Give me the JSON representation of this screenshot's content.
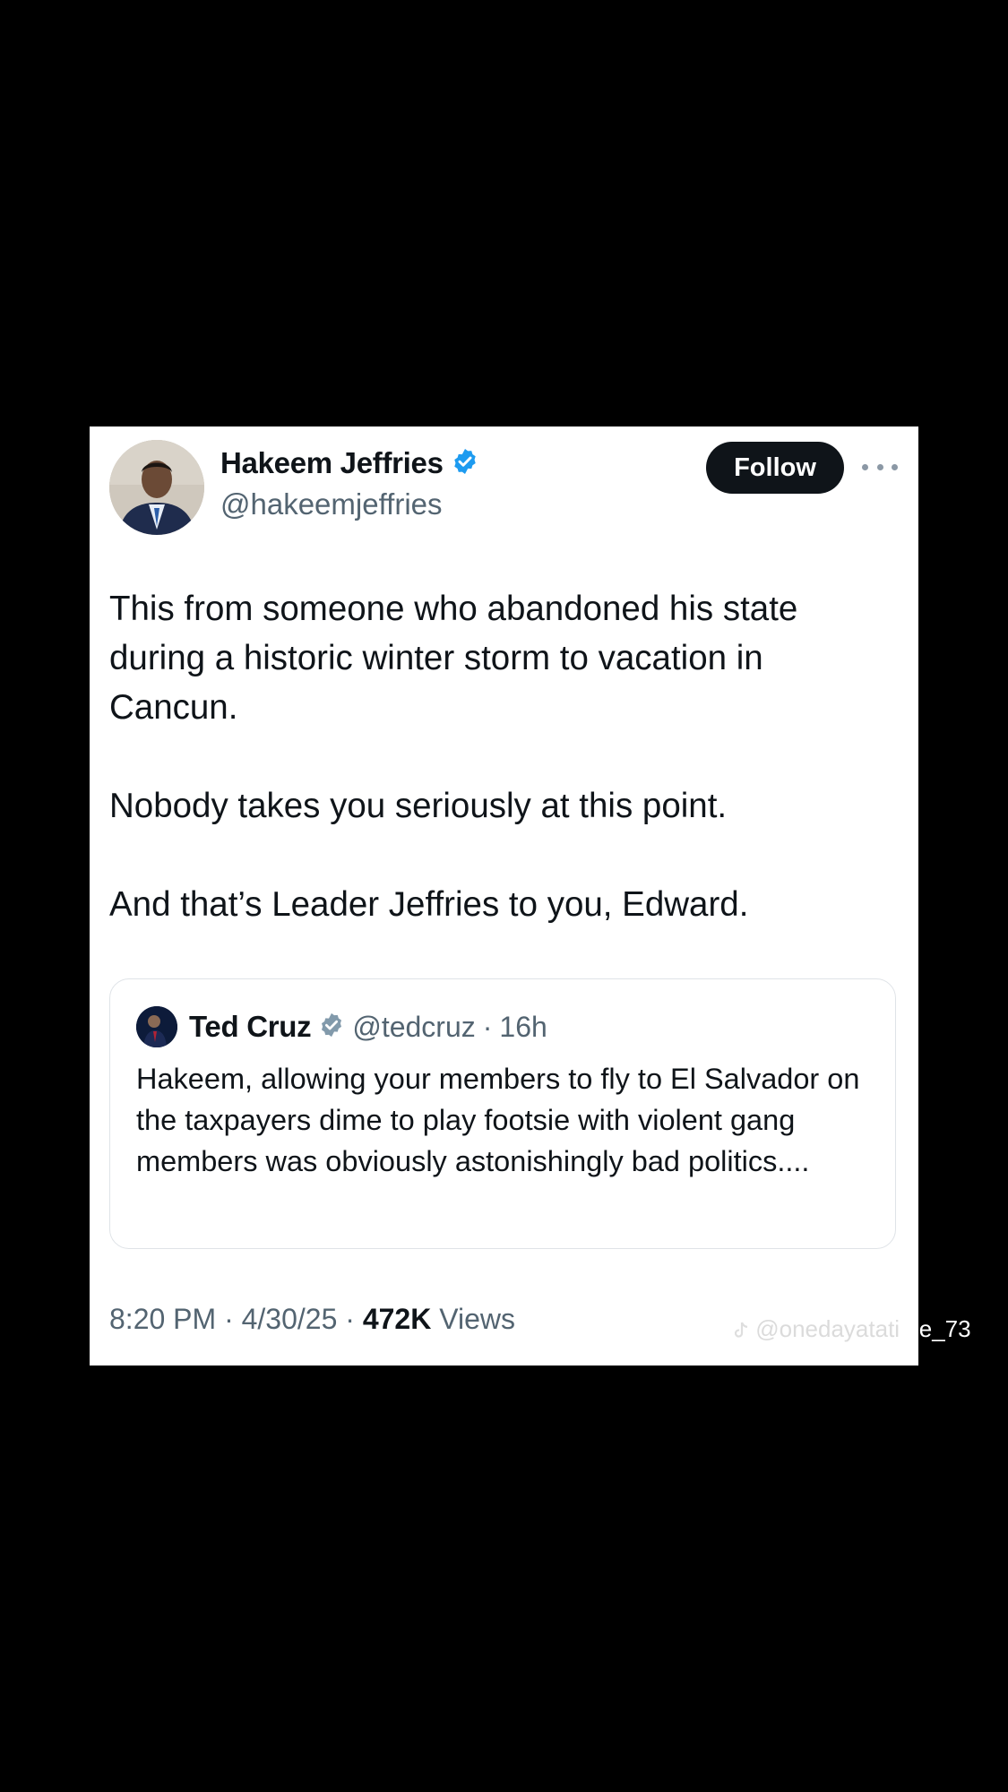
{
  "tweet": {
    "author": {
      "display_name": "Hakeem Jeffries",
      "handle": "@hakeemjeffries",
      "verified_badge": "verified-badge-icon",
      "badge_color": "#1d9bf0"
    },
    "follow_label": "Follow",
    "more_icon": "more-options-icon",
    "paragraphs": [
      "This from someone who abandoned his state during a historic winter storm to vacation in Cancun.",
      "Nobody takes you seriously at this point.",
      "And that’s Leader Jeffries to you, Edward."
    ],
    "quote": {
      "display_name": "Ted Cruz",
      "verified_badge": "verified-badge-icon",
      "badge_color": "#829aab",
      "handle": "@tedcruz",
      "separator": "·",
      "time": "16h",
      "text": "Hakeem, allowing your members to fly to El Salvador on the taxpayers dime to play footsie with violent gang members was obviously astonishingly bad politics...."
    },
    "meta": {
      "time": "8:20 PM",
      "separator": "·",
      "date": "4/30/25",
      "views_count": "472K",
      "views_label": "Views"
    }
  },
  "watermark": {
    "icon": "tiktok-icon",
    "text_faded": "@onedayatati",
    "text_tail": "me_73"
  },
  "colors": {
    "background": "#000000",
    "card": "#ffffff",
    "text_primary": "#0f1419",
    "text_secondary": "#536471",
    "follow_button": "#0f1419"
  }
}
